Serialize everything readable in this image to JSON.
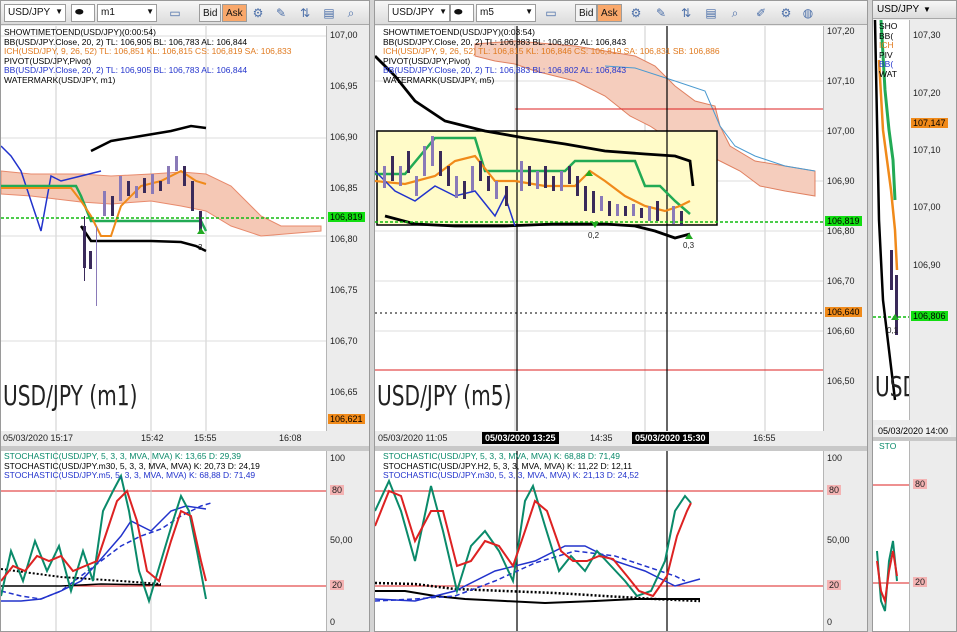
{
  "windows": [
    {
      "symbol": "USD/JPY",
      "timeframe": "m1",
      "bid": "Bid",
      "ask": "Ask",
      "legend": [
        {
          "text": "SHOWTIMETOEND(USD/JPY)(0:00:54)",
          "color": "#111"
        },
        {
          "text": "BB(USD/JPY.Close, 20, 2)  TL: 106,905  BL: 106,783  AL: 106,844",
          "color": "#111"
        },
        {
          "text": "ICH(USD/JPY, 9, 26, 52)  TL: 106,851  KL: 106,815  CS: 106,819  SA: 106,833",
          "color": "#e07a1f"
        },
        {
          "text": "PIVOT(USD/JPY,Pivot)",
          "color": "#111"
        },
        {
          "text": "BB(USD/JPY.Close, 20, 2)  TL: 106,905  BL: 106,783  AL: 106,844",
          "color": "#111"
        },
        {
          "text": "WATERMARK(USD/JPY, m1)",
          "color": "#111"
        }
      ],
      "price_ticks": [
        "107,00",
        "106,95",
        "106,90",
        "106,85",
        "106,80",
        "106,75",
        "106,70",
        "106,65"
      ],
      "price_tag_green": "106,819",
      "price_tag_orange": "106,621",
      "time_labels": [
        "05/03/2020 15:17",
        "15:42",
        "15:55",
        "16:08"
      ],
      "watermark": "USD/JPY (m1)",
      "marker_labels": [
        "3"
      ],
      "stoch_legend": [
        {
          "text": "STOCHASTIC(USD/JPY, 5, 3, 3, MVA, MVA)  K: 13,65  D: 29,39",
          "color": "#0a8a6a"
        },
        {
          "text": "STOCHASTIC(USD/JPY.m30, 5, 3, 3, MVA, MVA)  K: 20,73  D: 24,19",
          "color": "#111"
        },
        {
          "text": "STOCHASTIC(USD/JPY.m5, 5, 3, 3, MVA, MVA)  K: 68,88  D: 71,49",
          "color": "#2233cc"
        }
      ],
      "stoch_ticks": [
        "100",
        "80",
        "50,00",
        "20",
        "0"
      ]
    },
    {
      "symbol": "USD/JPY",
      "timeframe": "m5",
      "bid": "Bid",
      "ask": "Ask",
      "legend": [
        {
          "text": "SHOWTIMETOEND(USD/JPY)(0:03:54)",
          "color": "#111"
        },
        {
          "text": "BB(USD/JPY.Close, 20, 2)  TL: 106,883  BL: 106,802  AL: 106,843",
          "color": "#111"
        },
        {
          "text": "ICH(USD/JPY, 9, 26, 52)  TL: 106,815  KL: 106,846  CS: 106,819  SA: 106,831  SB: 106,886",
          "color": "#e07a1f"
        },
        {
          "text": "PIVOT(USD/JPY,Pivot)",
          "color": "#111"
        },
        {
          "text": "BB(USD/JPY.Close, 20, 2)  TL: 106,883  BL: 106,802  AL: 106,843",
          "color": "#111"
        },
        {
          "text": "WATERMARK(USD/JPY, m5)",
          "color": "#111"
        }
      ],
      "price_ticks": [
        "107,20",
        "107,10",
        "107,00",
        "106,90",
        "106,80",
        "106,70",
        "106,60",
        "106,50"
      ],
      "price_tag_green": "106,819",
      "price_tag_orange": "106,640",
      "time_labels": [
        "05/03/2020 11:05",
        "14:35",
        "16:55"
      ],
      "time_boxes": [
        "05/03/2020 13:25",
        "05/03/2020 15:30"
      ],
      "watermark": "USD/JPY (m5)",
      "marker_labels": [
        "0,2",
        "0,3"
      ],
      "stoch_legend": [
        {
          "text": "STOCHASTIC(USD/JPY, 5, 3, 3, MVA, MVA)  K: 68,88  D: 71,49",
          "color": "#0a8a6a"
        },
        {
          "text": "STOCHASTIC(USD/JPY.H2, 5, 3, 3, MVA, MVA)  K: 11,22  D: 12,11",
          "color": "#111"
        },
        {
          "text": "STOCHASTIC(USD/JPY.m30, 5, 3, 3, MVA, MVA)  K: 21,13  D: 24,52",
          "color": "#2233cc"
        }
      ],
      "stoch_ticks": [
        "100",
        "80",
        "50,00",
        "20",
        "0"
      ]
    },
    {
      "symbol": "USD/JPY",
      "legend": [
        {
          "text": "SHO",
          "color": "#111"
        },
        {
          "text": "BB(",
          "color": "#111"
        },
        {
          "text": "ICH",
          "color": "#e07a1f"
        },
        {
          "text": "PIV",
          "color": "#111"
        },
        {
          "text": "BB(",
          "color": "#111"
        },
        {
          "text": "WAT",
          "color": "#111"
        }
      ],
      "price_ticks": [
        "107,30",
        "107,20",
        "107,10",
        "107,00",
        "106,90"
      ],
      "price_tag_orange": "107,147",
      "price_tag_green": "106,806",
      "time_box": "05/03/2020 14:00",
      "watermark": "USD",
      "marker_labels": [
        "0,1"
      ],
      "stoch_legend_text": "STO",
      "stoch_ticks": [
        "80",
        "20"
      ]
    }
  ]
}
